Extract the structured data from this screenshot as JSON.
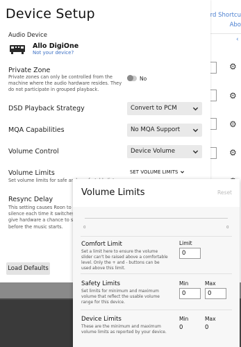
{
  "background": {
    "links": [
      "oard Shortcu",
      "Abo"
    ],
    "gear_icon": "gear-icon",
    "selector_glyph": "‹"
  },
  "dialog": {
    "title": "Device Setup",
    "audio_device": {
      "label": "Audio Device",
      "name": "Allo DigiOne",
      "link": "Not your device?",
      "icon": "device-icon"
    },
    "private_zone": {
      "label": "Private Zone",
      "description": "Private zones can only be controlled from the machine where the audio hardware resides. They do not participate in grouped playback.",
      "toggle_label": "No",
      "enabled": false
    },
    "dsd_playback": {
      "label": "DSD Playback Strategy",
      "value": "Convert to PCM"
    },
    "mqa_capabilities": {
      "label": "MQA Capabilities",
      "value": "No MQA Support"
    },
    "volume_control": {
      "label": "Volume Control",
      "value": "Device Volume"
    },
    "volume_limits": {
      "label": "Volume Limits",
      "description": "Set volume limits for safe and comfortable listening",
      "button_label": "SET VOLUME LIMITS"
    },
    "resync_delay": {
      "label": "Resync Delay",
      "description": "This setting causes Roon to produce silence each time it switches formats to give hardware a chance to synchronize before the music starts."
    },
    "load_defaults": "Load Defaults"
  },
  "popup": {
    "title": "Volume Limits",
    "reset": "Reset",
    "slider": {
      "min_label": "0",
      "max_label": "0"
    },
    "comfort_limit": {
      "title": "Comfort Limit",
      "description": "Set a limit here to ensure the volume slider can't be raised above a comfortable level. Only the + and - buttons can be used above this limit.",
      "field_label": "Limit",
      "value": "0"
    },
    "safety_limits": {
      "title": "Safety Limits",
      "description": "Set limits for minimum and maximum volume that reflect the usable volume range for this device.",
      "min_label": "Min",
      "max_label": "Max",
      "min_value": "0",
      "max_value": "0"
    },
    "device_limits": {
      "title": "Device Limits",
      "description": "These are the minimum and maximum volume limits as reported by your device.",
      "min_label": "Min",
      "max_label": "Max",
      "min_value": "0",
      "max_value": "0"
    }
  },
  "colors": {
    "accent": "#3a6fc4",
    "select_bg": "#e9e9e9",
    "dark_bar": "#4a4a4a"
  }
}
